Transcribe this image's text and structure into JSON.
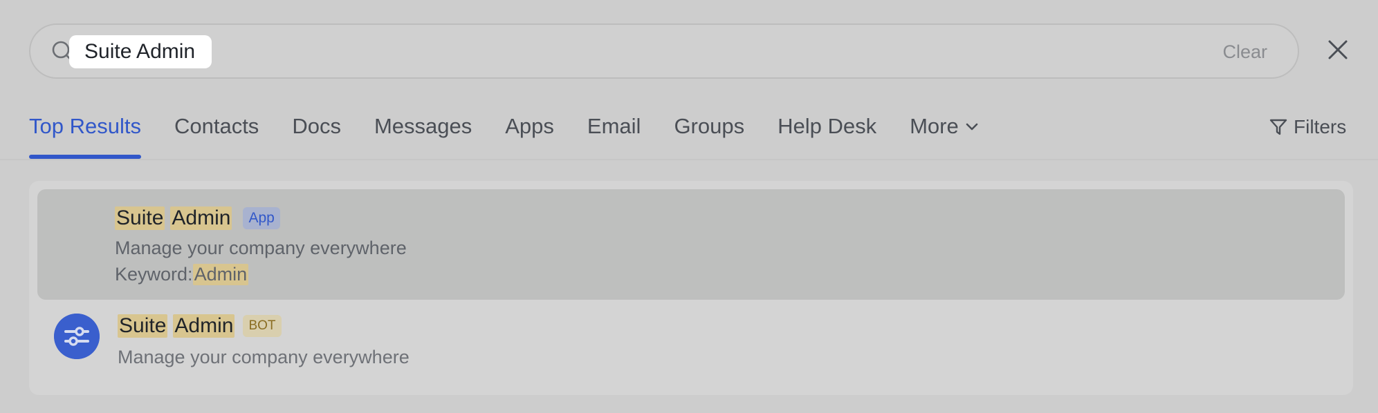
{
  "search": {
    "value": "Suite Admin",
    "clear_label": "Clear"
  },
  "tabs": [
    {
      "label": "Top Results",
      "active": true
    },
    {
      "label": "Contacts"
    },
    {
      "label": "Docs"
    },
    {
      "label": "Messages"
    },
    {
      "label": "Apps"
    },
    {
      "label": "Email"
    },
    {
      "label": "Groups"
    },
    {
      "label": "Help Desk"
    },
    {
      "label": "More"
    }
  ],
  "filters_label": "Filters",
  "results": [
    {
      "title_words": [
        "Suite",
        "Admin"
      ],
      "tag": "App",
      "description": "Manage your company everywhere",
      "keyword_label": "Keyword: ",
      "keyword_value": "Admin"
    },
    {
      "title_words": [
        "Suite",
        "Admin"
      ],
      "tag": "BOT",
      "description": "Manage your company everywhere"
    }
  ],
  "colors": {
    "accent": "#3157c9",
    "highlight": "#d8c58f",
    "selected_row": "#bebfbe",
    "bot_avatar": "#3a5fcd"
  }
}
